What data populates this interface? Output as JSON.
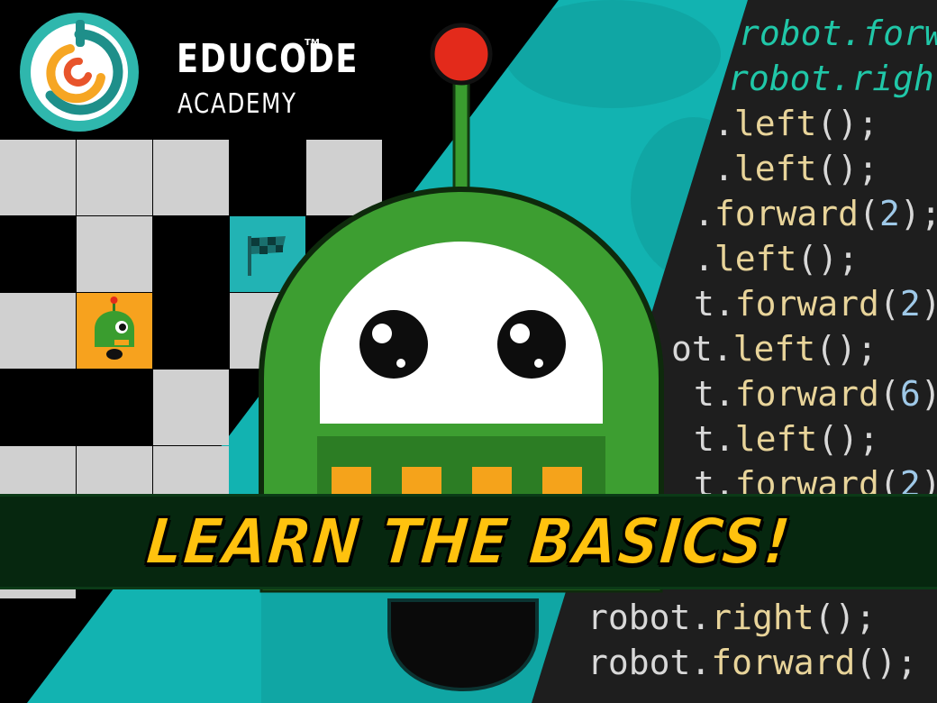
{
  "logo": {
    "line1": "EDUCODE",
    "trademark": "TM",
    "line2": "ACADEMY",
    "icon": "educode-logo-icon"
  },
  "banner": {
    "text": "LEARN THE BASICS!"
  },
  "code": {
    "lines": [
      {
        "prefix": "robot",
        "fn": "forw",
        "args": "",
        "close": ""
      },
      {
        "prefix": "robot",
        "fn": "righ",
        "args": "",
        "close": ""
      },
      {
        "prefix": "",
        "fn": "left",
        "args": "",
        "close": "();"
      },
      {
        "prefix": "",
        "fn": "left",
        "args": "",
        "close": "();"
      },
      {
        "prefix": "",
        "fn": "forward",
        "args": "2",
        "close": ");"
      },
      {
        "prefix": "",
        "fn": "left",
        "args": "",
        "close": "();"
      },
      {
        "prefix": "t",
        "fn": "forward",
        "args": "2",
        "close": ");"
      },
      {
        "prefix": "ot",
        "fn": "left",
        "args": "",
        "close": "();"
      },
      {
        "prefix": "t",
        "fn": "forward",
        "args": "6",
        "close": ");"
      },
      {
        "prefix": "t",
        "fn": "left",
        "args": "",
        "close": "();"
      },
      {
        "prefix": "t",
        "fn": "forward",
        "args": "2",
        "close": ");"
      },
      {
        "prefix": "robot",
        "fn": "right",
        "args": "",
        "close": "();"
      },
      {
        "prefix": "robot",
        "fn": "forward",
        "args": "",
        "close": "();"
      }
    ]
  },
  "colors": {
    "teal": "#11b2b0",
    "robot_green": "#3a9d2f",
    "banner_bg": "#06270f",
    "banner_text": "#ffc20e",
    "cell_light": "#d0d0d0",
    "cell_dark": "#000000",
    "cell_goal": "#22b3b4",
    "cell_robot": "#f7a21e"
  }
}
